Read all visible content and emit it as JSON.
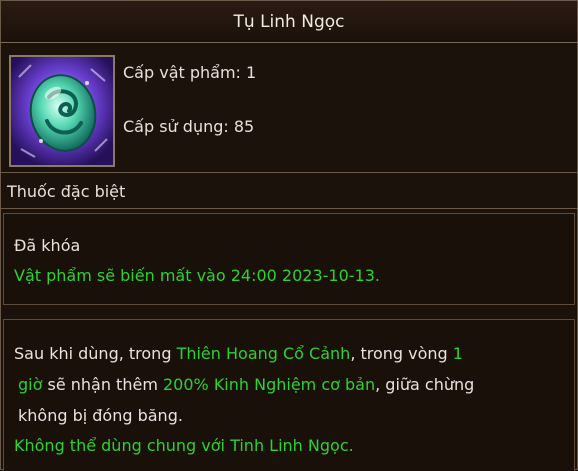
{
  "item": {
    "name": "Tụ Linh Ngọc",
    "icon": "jade-orb-icon",
    "item_level_label": "Cấp vật phẩm: 1",
    "use_level_label": "Cấp sử dụng: 85",
    "type_label": "Thuốc đặc biệt"
  },
  "status": {
    "locked_label": "Đã khóa",
    "expiry_text": "Vật phẩm sẽ biến mất vào 24:00 2023-10-13."
  },
  "description": {
    "line1": [
      {
        "text": "Sau khi dùng, trong ",
        "color": "white"
      },
      {
        "text": "Thiên Hoang Cổ Cảnh",
        "color": "green"
      },
      {
        "text": ", trong vòng ",
        "color": "white"
      },
      {
        "text": "1",
        "color": "green"
      }
    ],
    "line2": [
      {
        "text": "giờ",
        "color": "green"
      },
      {
        "text": " sẽ nhận thêm ",
        "color": "white"
      },
      {
        "text": "200% Kinh Nghiệm cơ bản",
        "color": "green"
      },
      {
        "text": ", giữa chừng",
        "color": "white"
      }
    ],
    "line3": [
      {
        "text": "không bị đóng băng.",
        "color": "white"
      }
    ],
    "warning": "Không thể dùng chung với Tinh Linh Ngọc."
  },
  "colors": {
    "green_text": "#2fd12f",
    "white_text": "#e9e3d8",
    "border": "#6b5a48",
    "background": "#1c120c"
  }
}
